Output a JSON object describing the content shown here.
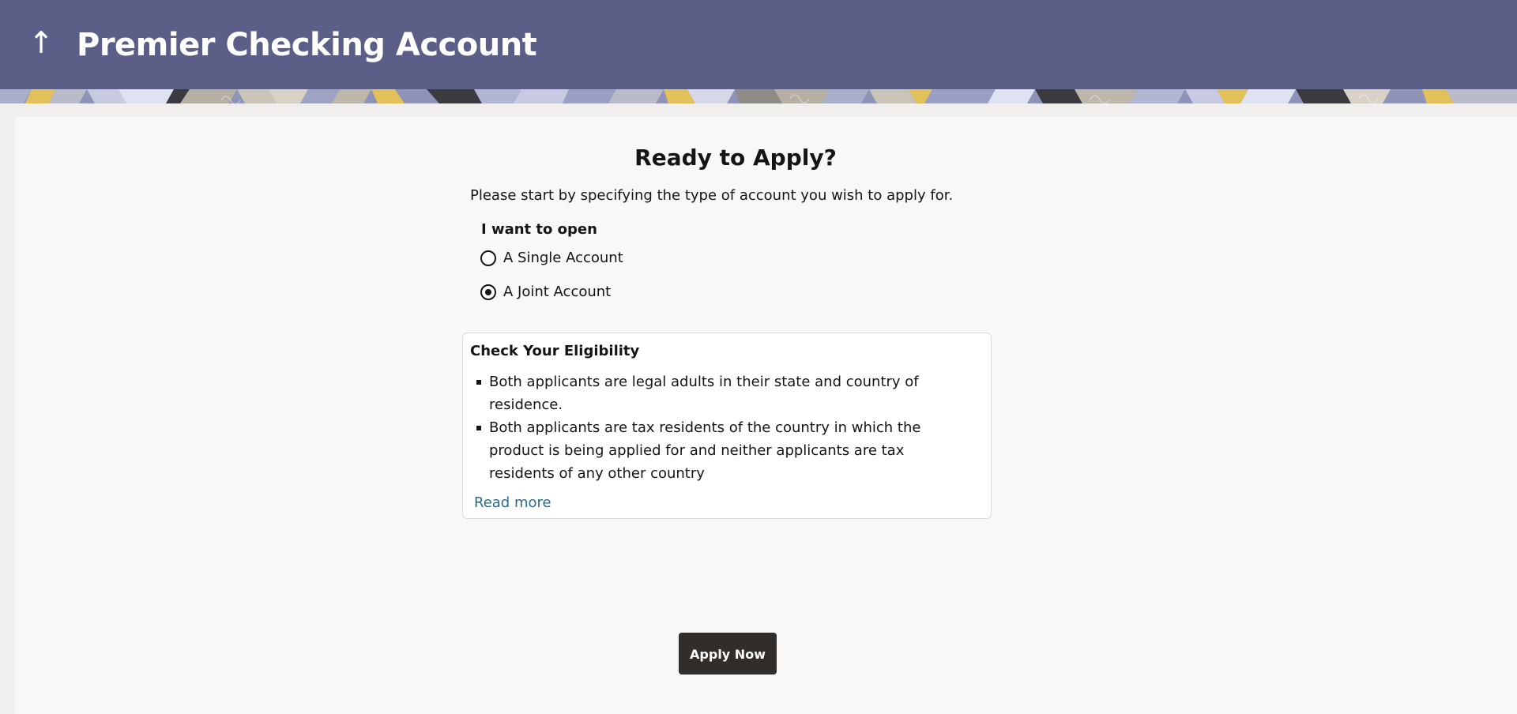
{
  "header": {
    "back_symbol": "↑",
    "title": "Premier Checking Account",
    "background_color": "#5b5f88"
  },
  "main": {
    "heading": "Ready to Apply?",
    "intro": "Please start by specifying the type of account you wish to apply for.",
    "account_type": {
      "label": "I want to open",
      "options": [
        {
          "label": "A Single Account",
          "selected": false
        },
        {
          "label": "A Joint Account",
          "selected": true
        }
      ]
    },
    "eligibility": {
      "title": "Check Your Eligibility",
      "items": [
        "Both applicants are legal adults in their state and country of residence.",
        "Both applicants are tax residents of the country in which the product is being applied for and neither applicants are tax residents of any other country"
      ],
      "read_more": "Read more",
      "link_color": "#2b6b8f"
    },
    "apply_button": {
      "label": "Apply Now",
      "color": "#312d2a"
    }
  }
}
